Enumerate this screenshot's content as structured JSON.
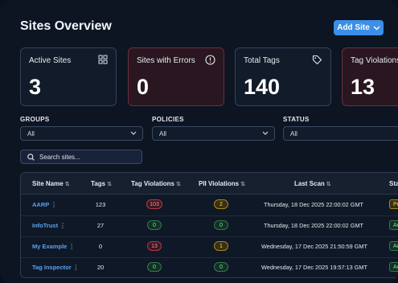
{
  "header": {
    "title": "Sites Overview",
    "add_button": "Add Site"
  },
  "cards": [
    {
      "label": "Active Sites",
      "value": "3",
      "icon": "grid-icon"
    },
    {
      "label": "Sites with Errors",
      "value": "0",
      "icon": "alert-circle-icon"
    },
    {
      "label": "Total Tags",
      "value": "140",
      "icon": "tag-icon"
    },
    {
      "label": "Tag Violations",
      "value": "13",
      "icon": ""
    }
  ],
  "filters": {
    "groups": {
      "label": "GROUPS",
      "value": "All"
    },
    "policies": {
      "label": "POLICIES",
      "value": "All"
    },
    "status": {
      "label": "STATUS",
      "value": "All"
    }
  },
  "search": {
    "placeholder": "Search sites..."
  },
  "table": {
    "columns": [
      "Site Name",
      "Tags",
      "Tag Violations",
      "PII Violations",
      "Last Scan",
      "Sta"
    ],
    "rows": [
      {
        "site": "AARP",
        "tags": "123",
        "tag_violations": "103",
        "pii_violations": "2",
        "last_scan": "Thursday, 18 Dec 2025 22:00:02 GMT",
        "status": "Pe"
      },
      {
        "site": "InfoTrust",
        "tags": "27",
        "tag_violations": "0",
        "pii_violations": "0",
        "last_scan": "Thursday, 18 Dec 2025 22:00:02 GMT",
        "status": "Ac"
      },
      {
        "site": "My Example",
        "tags": "0",
        "tag_violations": "13",
        "pii_violations": "1",
        "last_scan": "Wednesday, 17 Dec 2025 21:50:59 GMT",
        "status": "Ac"
      },
      {
        "site": "Tag Inspector",
        "tags": "20",
        "tag_violations": "0",
        "pii_violations": "0",
        "last_scan": "Wednesday, 17 Dec 2025 19:57:13 GMT",
        "status": "Ac"
      }
    ]
  },
  "colors": {
    "accent": "#3c8ee6",
    "error_card": "#2a1620",
    "red_badge": "#ff8c98",
    "green_badge": "#7fe0a3",
    "yellow_badge": "#f3d35a"
  }
}
